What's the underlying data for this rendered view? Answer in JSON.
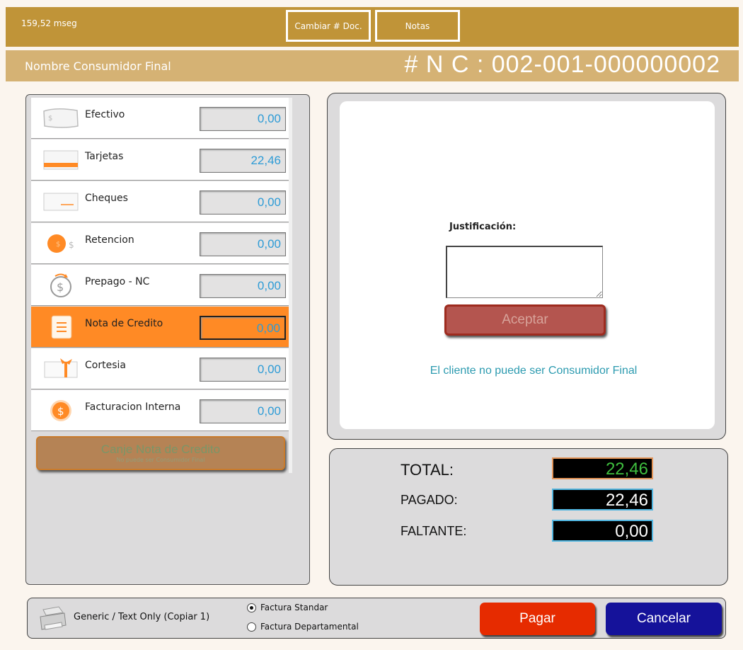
{
  "header": {
    "timing": "159,52 mseg",
    "change_doc_label": "Cambiar # Doc.",
    "notes_label": "Notas"
  },
  "subheader": {
    "consumer_name": "Nombre Consumidor Final",
    "doc_number": "# N C : 002-001-000000002"
  },
  "payment_methods": [
    {
      "label": "Efectivo",
      "amount": "0,00",
      "icon": "cash-icon",
      "active": false
    },
    {
      "label": "Tarjetas",
      "amount": "22,46",
      "icon": "card-icon",
      "active": false
    },
    {
      "label": "Cheques",
      "amount": "0,00",
      "icon": "check-icon",
      "active": false
    },
    {
      "label": "Retencion",
      "amount": "0,00",
      "icon": "coin-icon",
      "active": false
    },
    {
      "label": "Prepago - NC",
      "amount": "0,00",
      "icon": "refund-coin-icon",
      "active": false
    },
    {
      "label": "Nota de Credito",
      "amount": "0,00",
      "icon": "note-icon",
      "active": true
    },
    {
      "label": "Cortesia",
      "amount": "0,00",
      "icon": "gift-icon",
      "active": false
    },
    {
      "label": "Facturacion Interna",
      "amount": "0,00",
      "icon": "dollar-coin-icon",
      "active": false
    }
  ],
  "canje": {
    "title": "Canje Nota de Credito",
    "subtitle": "No puede ser Consumidor Final"
  },
  "justification": {
    "label": "Justificación:",
    "value": "",
    "accept_label": "Aceptar",
    "warning": "El cliente no puede ser Consumidor Final"
  },
  "totals": {
    "total_label": "TOTAL:",
    "total_value": "22,46",
    "paid_label": "PAGADO:",
    "paid_value": "22,46",
    "missing_label": "FALTANTE:",
    "missing_value": "0,00"
  },
  "footer": {
    "printer": "Generic / Text Only (Copiar 1)",
    "radio_standard": "Factura Standar",
    "radio_departmental": "Factura Departamental",
    "selected_radio": "standard",
    "pay_label": "Pagar",
    "cancel_label": "Cancelar"
  },
  "colors": {
    "brand_gold": "#c09438",
    "brand_light_gold": "#d5b274",
    "active_orange": "#ff8a25",
    "amount_blue": "#2d9bd6",
    "pay_red": "#e62b00",
    "cancel_blue": "#15129a"
  }
}
